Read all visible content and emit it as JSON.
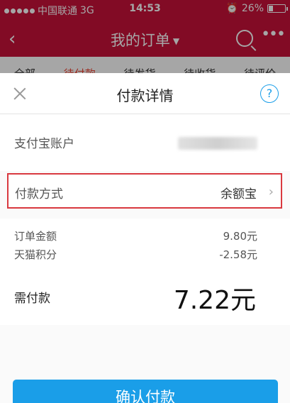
{
  "status_bar": {
    "carrier": "中国联通",
    "network": "3G",
    "time": "14:53",
    "battery": "26%",
    "battery_level": 0.26
  },
  "app_bar": {
    "title": "我的订单",
    "back_icon": "chevron-left-icon",
    "search_icon": "search-icon",
    "more_icon": "more-icon"
  },
  "tabs": [
    "全部",
    "待付款",
    "待发货",
    "待收货",
    "待评价"
  ],
  "payment_sheet": {
    "title": "付款详情",
    "close_icon": "close-icon",
    "help_label": "?",
    "account_label": "支付宝账户",
    "method_label": "付款方式",
    "method_value": "余额宝",
    "order_amount_label": "订单金额",
    "order_amount_value": "9.80元",
    "points_label": "天猫积分",
    "points_value": "-2.58元",
    "due_label": "需付款",
    "due_value": "7.22元",
    "confirm_label": "确认付款"
  },
  "colors": {
    "brand_red": "#c8123a",
    "alipay_blue": "#1a9ee8",
    "highlight_border": "#d9393f"
  }
}
